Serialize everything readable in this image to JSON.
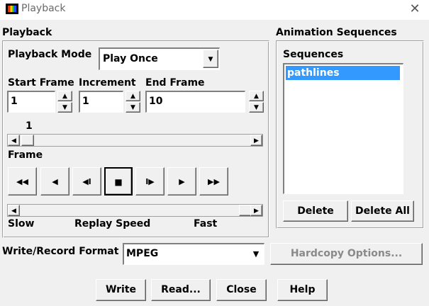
{
  "window": {
    "title": "Playback",
    "icon": "fluent-app-icon",
    "close_icon": "close-icon"
  },
  "playback": {
    "group_label": "Playback",
    "mode_label": "Playback Mode",
    "mode_value": "Play Once",
    "start_frame_label": "Start Frame",
    "increment_label": "Increment",
    "end_frame_label": "End Frame",
    "start_frame_value": "1",
    "increment_value": "1",
    "end_frame_value": "10",
    "frame_value_label": "1",
    "frame_label": "Frame",
    "frame_slider_position": 0,
    "speed_slider_position": 1,
    "speed_slow": "Slow",
    "speed_label": "Replay Speed",
    "speed_fast": "Fast",
    "controls": {
      "rewind": "◀◀",
      "step_back": "◀",
      "prev": "◀I",
      "stop": "■",
      "next": "I▶",
      "play": "▶",
      "fast_forward": "▶▶"
    }
  },
  "animation": {
    "group_label": "Animation Sequences",
    "list_label": "Sequences",
    "items": [
      "pathlines"
    ],
    "delete_label": "Delete",
    "delete_all_label": "Delete All"
  },
  "format": {
    "label": "Write/Record Format",
    "value": "MPEG",
    "hardcopy_label": "Hardcopy Options..."
  },
  "footer": {
    "write_label": "Write",
    "read_label": "Read...",
    "close_label": "Close",
    "help_label": "Help"
  }
}
